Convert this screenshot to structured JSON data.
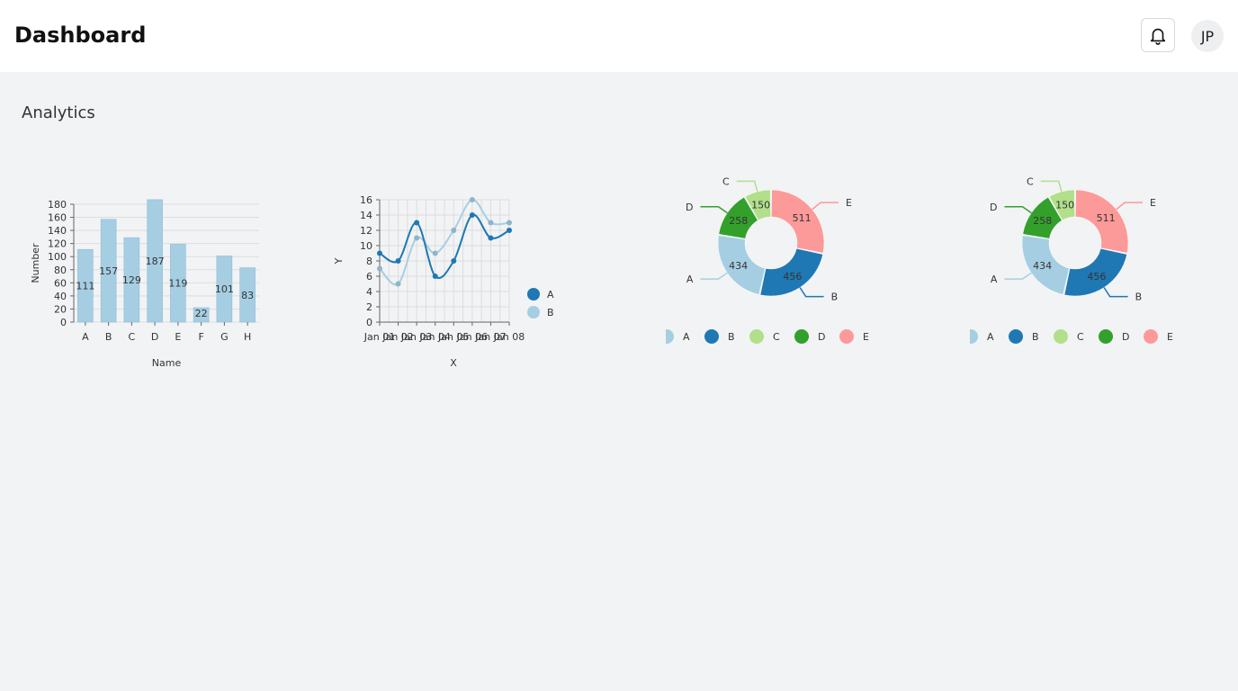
{
  "header": {
    "title": "Dashboard",
    "notifications_icon": "bell-icon",
    "avatar_initials": "JP"
  },
  "section": {
    "title": "Analytics"
  },
  "colors": {
    "light_blue": "#a6cee3",
    "dark_blue": "#1f78b4",
    "light_green": "#b2df8a",
    "dark_green": "#33a02c",
    "pink": "#fb9a99"
  },
  "chart_data": [
    {
      "type": "bar",
      "categories": [
        "A",
        "B",
        "C",
        "D",
        "E",
        "F",
        "G",
        "H"
      ],
      "values": [
        111,
        157,
        129,
        187,
        119,
        22,
        101,
        83
      ],
      "xlabel": "Name",
      "ylabel": "Number",
      "ylim": [
        0,
        180
      ],
      "yticks": [
        0,
        20,
        40,
        60,
        80,
        100,
        120,
        140,
        160,
        180
      ],
      "grid": true
    },
    {
      "type": "line",
      "x": [
        "Jan 01",
        "Jan 02",
        "Jan 03",
        "Jan 04",
        "Jan 05",
        "Jan 06",
        "Jan 07",
        "Jan 08"
      ],
      "series": [
        {
          "name": "A",
          "values": [
            9,
            8,
            13,
            6,
            8,
            14,
            11,
            12
          ]
        },
        {
          "name": "B",
          "values": [
            7,
            5,
            11,
            9,
            12,
            16,
            13,
            13
          ]
        }
      ],
      "xlabel": "X",
      "ylabel": "Y",
      "ylim": [
        0,
        16
      ],
      "yticks": [
        0,
        2,
        4,
        6,
        8,
        10,
        12,
        14,
        16
      ],
      "grid": true,
      "legend": "right"
    },
    {
      "type": "pie",
      "donut": true,
      "categories": [
        "A",
        "B",
        "C",
        "D",
        "E"
      ],
      "values": [
        434,
        456,
        150,
        258,
        511
      ],
      "legend": "bottom"
    },
    {
      "type": "pie",
      "donut": true,
      "categories": [
        "A",
        "B",
        "C",
        "D",
        "E"
      ],
      "values": [
        434,
        456,
        150,
        258,
        511
      ],
      "legend": "bottom"
    }
  ]
}
